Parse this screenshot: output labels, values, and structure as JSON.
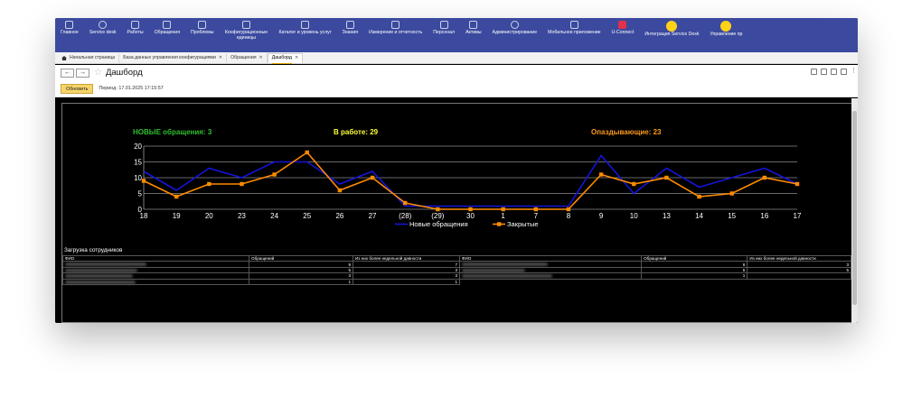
{
  "nav": [
    {
      "label": "Главное",
      "icon": "home-icon"
    },
    {
      "label": "Service desk",
      "icon": "service-desk-icon"
    },
    {
      "label": "Работы",
      "icon": "wrench-icon"
    },
    {
      "label": "Обращения",
      "icon": "ticket-icon"
    },
    {
      "label": "Проблемы",
      "icon": "problem-icon"
    },
    {
      "label": "Конфигурационные единицы",
      "icon": "config-icon"
    },
    {
      "label": "Каталог и уровень услуг",
      "icon": "catalog-icon"
    },
    {
      "label": "Знания",
      "icon": "knowledge-icon"
    },
    {
      "label": "Измерение и отчетность",
      "icon": "chart-icon"
    },
    {
      "label": "Персонал",
      "icon": "people-icon"
    },
    {
      "label": "Активы",
      "icon": "assets-icon"
    },
    {
      "label": "Администрирование",
      "icon": "gear-icon"
    },
    {
      "label": "Мобильное приложение",
      "icon": "mobile-icon"
    },
    {
      "label": "U-Connect",
      "icon": "u-connect-icon"
    },
    {
      "label": "Интеграция Service Desk",
      "icon": "integration-icon"
    },
    {
      "label": "Управление пр",
      "icon": "management-icon"
    }
  ],
  "tabs": {
    "home": "Начальная страница",
    "items": [
      {
        "label": "База данных управления конфигурациями"
      },
      {
        "label": "Обращения"
      },
      {
        "label": "Дашборд",
        "active": true
      }
    ]
  },
  "page": {
    "title": "Дашборд",
    "back": "←",
    "forward": "→",
    "refresh": "Обновить",
    "period": "Период: 17.01.2025 17:15:57"
  },
  "stats": {
    "new": "НОВЫЕ обращения: 3",
    "in_work": "В работе: 29",
    "overdue": "Опаздывающие: 23",
    "colors": {
      "new": "#2fbf2f",
      "in_work": "#ffff33",
      "overdue": "#ff9a1a"
    }
  },
  "chart_data": {
    "type": "line",
    "categories": [
      "18",
      "19",
      "20",
      "23",
      "24",
      "25",
      "26",
      "27",
      "(28)",
      "(29)",
      "30",
      "1",
      "7",
      "8",
      "9",
      "10",
      "13",
      "14",
      "15",
      "16",
      "17"
    ],
    "series": [
      {
        "name": "Новые обращения",
        "color": "#1414d8",
        "values": [
          12,
          6,
          13,
          10,
          15,
          15,
          8,
          12,
          1,
          1,
          1,
          1,
          1,
          1,
          17,
          5,
          13,
          7,
          10,
          13,
          8
        ]
      },
      {
        "name": "Закрытые",
        "color": "#ff8c00",
        "values": [
          9,
          4,
          8,
          8,
          11,
          18,
          6,
          10,
          2,
          0,
          0,
          0,
          0,
          0,
          11,
          8,
          10,
          4,
          5,
          10,
          8
        ]
      }
    ],
    "yticks": [
      0,
      5,
      10,
      15,
      20
    ],
    "ylim": [
      0,
      20
    ],
    "grid": true,
    "legend": "bottom"
  },
  "employees": {
    "title": "Загрузка сотрудников",
    "headers": [
      "ФИО",
      "Обращений",
      "Из них более недельной давности"
    ],
    "left": [
      {
        "count": "9",
        "old": "7"
      },
      {
        "count": "5",
        "old": "3"
      },
      {
        "count": "3",
        "old": "3"
      },
      {
        "count": "1",
        "old": "1"
      }
    ],
    "right": [
      {
        "count": "6",
        "old": "3"
      },
      {
        "count": "5",
        "old": "5"
      },
      {
        "count": "1",
        "old": ""
      }
    ]
  }
}
